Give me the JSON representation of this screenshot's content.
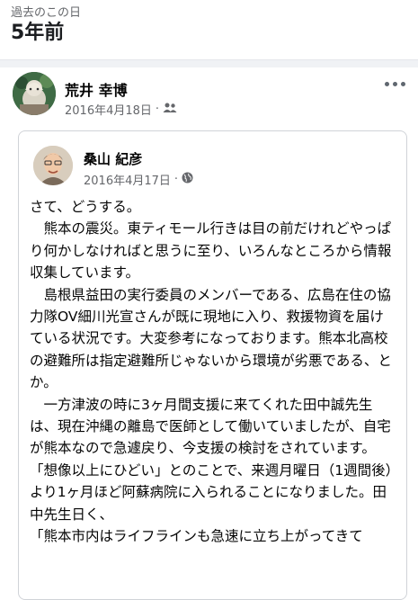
{
  "memory": {
    "label": "過去のこの日",
    "title": "5年前"
  },
  "outer_post": {
    "author": "荒井 幸博",
    "date": "2016年4月18日",
    "separator": "·",
    "audience_icon": "friends-icon",
    "menu_icon": "more-icon"
  },
  "shared_post": {
    "author": "桑山 紀彦",
    "date": "2016年4月17日",
    "separator": "·",
    "audience_icon": "globe-icon",
    "paragraphs": [
      "さて、どうする。",
      "　熊本の震災。東ティモール行きは目の前だけれどやっぱり何かしなければと思うに至り、いろんなところから情報収集しています。",
      "　島根県益田の実行委員のメンバーである、広島在住の協力隊OV細川光宣さんが既に現地に入り、救援物資を届けている状況です。大変参考になっております。熊本北高校の避難所は指定避難所じゃないから環境が劣悪である、とか。",
      "　一方津波の時に3ヶ月間支援に来てくれた田中誠先生は、現在沖縄の離島で医師として働いていましたが、自宅が熊本なので急遽戻り、今支援の検討をされています。",
      "「想像以上にひどい」とのことで、来週月曜日（1週間後）より1ヶ月ほど阿蘇病院に入られることになりました。田中先生日く、",
      "「熊本市内はライフラインも急速に立ち上がってきて"
    ]
  }
}
